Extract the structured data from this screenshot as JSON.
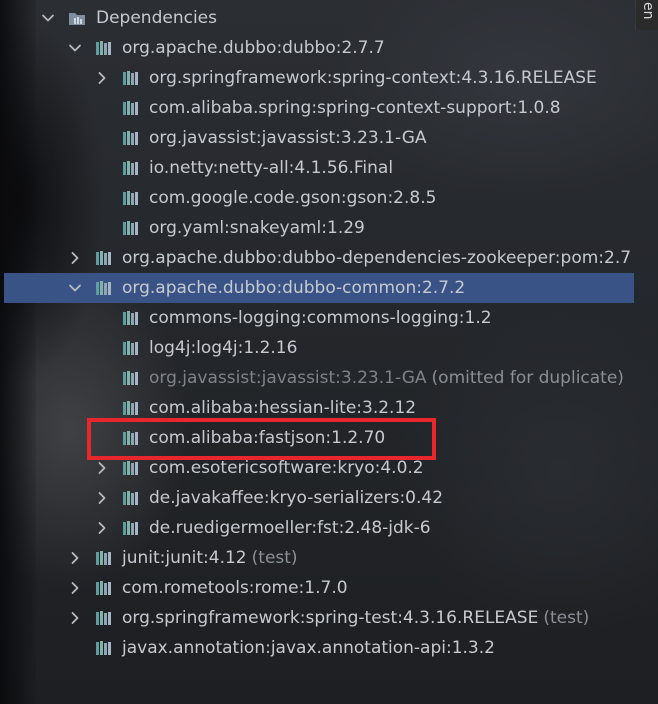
{
  "side_tab": {
    "label": "en"
  },
  "tree": [
    {
      "label": "Dependencies",
      "indent": 0,
      "expander": "expanded",
      "icon": "folder-icon",
      "dim": false,
      "suffix": "",
      "selected": false
    },
    {
      "label": "org.apache.dubbo:dubbo:2.7.7",
      "indent": 1,
      "expander": "expanded",
      "icon": "library-icon",
      "dim": false,
      "suffix": "",
      "selected": false
    },
    {
      "label": "org.springframework:spring-context:4.3.16.RELEASE",
      "indent": 2,
      "expander": "collapsed",
      "icon": "library-icon",
      "dim": false,
      "suffix": "",
      "selected": false
    },
    {
      "label": "com.alibaba.spring:spring-context-support:1.0.8",
      "indent": 2,
      "expander": "none",
      "icon": "library-icon",
      "dim": false,
      "suffix": "",
      "selected": false
    },
    {
      "label": "org.javassist:javassist:3.23.1-GA",
      "indent": 2,
      "expander": "none",
      "icon": "library-icon",
      "dim": false,
      "suffix": "",
      "selected": false
    },
    {
      "label": "io.netty:netty-all:4.1.56.Final",
      "indent": 2,
      "expander": "none",
      "icon": "library-icon",
      "dim": false,
      "suffix": "",
      "selected": false
    },
    {
      "label": "com.google.code.gson:gson:2.8.5",
      "indent": 2,
      "expander": "none",
      "icon": "library-icon",
      "dim": false,
      "suffix": "",
      "selected": false
    },
    {
      "label": "org.yaml:snakeyaml:1.29",
      "indent": 2,
      "expander": "none",
      "icon": "library-icon",
      "dim": false,
      "suffix": "",
      "selected": false
    },
    {
      "label": "org.apache.dubbo:dubbo-dependencies-zookeeper:pom:2.7",
      "indent": 1,
      "expander": "collapsed",
      "icon": "library-icon",
      "dim": false,
      "suffix": "",
      "selected": false
    },
    {
      "label": "org.apache.dubbo:dubbo-common:2.7.2",
      "indent": 1,
      "expander": "expanded",
      "icon": "library-icon",
      "dim": false,
      "suffix": "",
      "selected": true
    },
    {
      "label": "commons-logging:commons-logging:1.2",
      "indent": 2,
      "expander": "none",
      "icon": "library-icon",
      "dim": false,
      "suffix": "",
      "selected": false
    },
    {
      "label": "log4j:log4j:1.2.16",
      "indent": 2,
      "expander": "none",
      "icon": "library-icon",
      "dim": false,
      "suffix": "",
      "selected": false
    },
    {
      "label": "org.javassist:javassist:3.23.1-GA",
      "indent": 2,
      "expander": "none",
      "icon": "library-icon",
      "dim": true,
      "suffix": "(omitted for duplicate)",
      "selected": false
    },
    {
      "label": "com.alibaba:hessian-lite:3.2.12",
      "indent": 2,
      "expander": "none",
      "icon": "library-icon",
      "dim": false,
      "suffix": "",
      "selected": false
    },
    {
      "label": "com.alibaba:fastjson:1.2.70",
      "indent": 2,
      "expander": "none",
      "icon": "library-icon",
      "dim": false,
      "suffix": "",
      "selected": false
    },
    {
      "label": "com.esotericsoftware:kryo:4.0.2",
      "indent": 2,
      "expander": "collapsed",
      "icon": "library-icon",
      "dim": false,
      "suffix": "",
      "selected": false
    },
    {
      "label": "de.javakaffee:kryo-serializers:0.42",
      "indent": 2,
      "expander": "collapsed",
      "icon": "library-icon",
      "dim": false,
      "suffix": "",
      "selected": false
    },
    {
      "label": "de.ruedigermoeller:fst:2.48-jdk-6",
      "indent": 2,
      "expander": "collapsed",
      "icon": "library-icon",
      "dim": false,
      "suffix": "",
      "selected": false
    },
    {
      "label": "junit:junit:4.12",
      "indent": 1,
      "expander": "collapsed",
      "icon": "library-icon",
      "dim": false,
      "suffix": "(test)",
      "selected": false
    },
    {
      "label": "com.rometools:rome:1.7.0",
      "indent": 1,
      "expander": "collapsed",
      "icon": "library-icon",
      "dim": false,
      "suffix": "",
      "selected": false
    },
    {
      "label": "org.springframework:spring-test:4.3.16.RELEASE",
      "indent": 1,
      "expander": "collapsed",
      "icon": "library-icon",
      "dim": false,
      "suffix": "(test)",
      "selected": false
    },
    {
      "label": "javax.annotation:javax.annotation-api:1.3.2",
      "indent": 1,
      "expander": "none",
      "icon": "library-icon",
      "dim": false,
      "suffix": "",
      "selected": false
    }
  ],
  "annotation": {
    "highlighted_item": "com.alibaba:fastjson:1.2.70",
    "color": "#e8262b"
  },
  "colors": {
    "selection": "#3a5386",
    "text": "#c6cad0",
    "dim_text": "#7f848b",
    "icon_bars": [
      "#5f9ea0",
      "#7fb2a8",
      "#8fa7b3",
      "#a6b7c3"
    ]
  }
}
